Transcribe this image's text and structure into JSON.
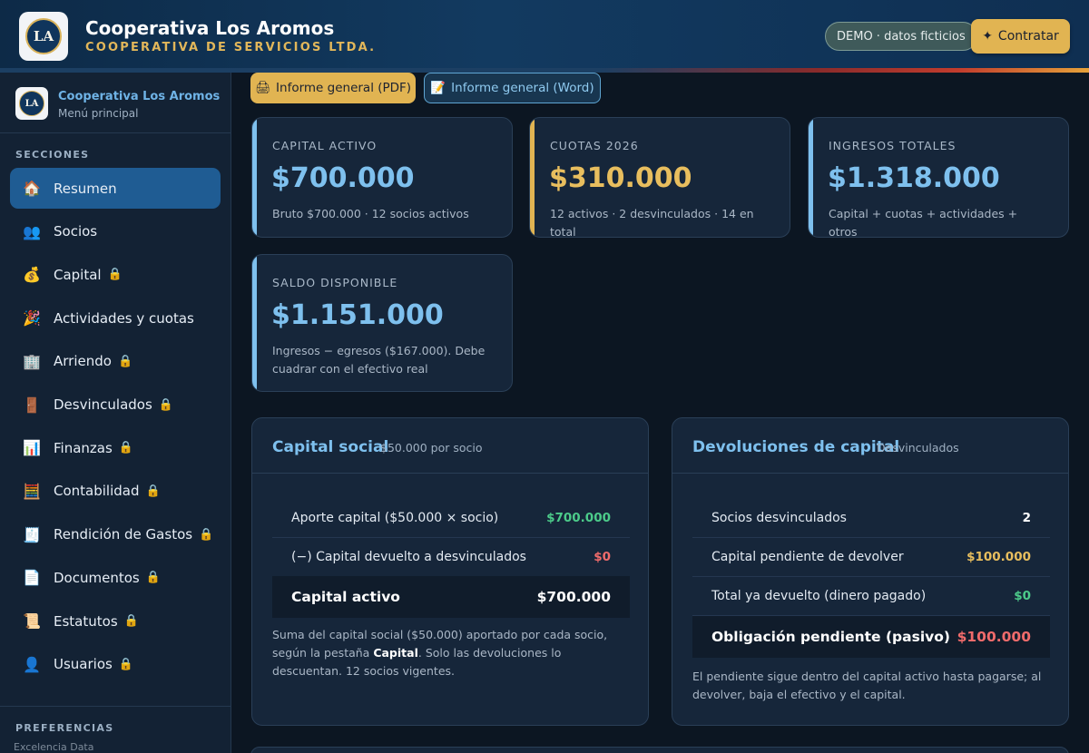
{
  "header": {
    "logo_initials": "LA",
    "title": "Cooperativa Los Aromos",
    "subtitle": "COOPERATIVA DE SERVICIOS LTDA.",
    "demo_badge": "DEMO · datos ficticios",
    "cta_icon": "✦",
    "cta_label": "Contratar"
  },
  "sidebar": {
    "logo_initials": "LA",
    "title": "Cooperativa Los Aromos",
    "subtitle": "Menú principal",
    "sections_label": "SECCIONES",
    "items": [
      {
        "icon": "🏠",
        "icon_name": "home-icon",
        "label": "Resumen",
        "locked": false,
        "active": true
      },
      {
        "icon": "👥",
        "icon_name": "users-icon",
        "label": "Socios",
        "locked": false,
        "active": false
      },
      {
        "icon": "💰",
        "icon_name": "money-bag-icon",
        "label": "Capital",
        "locked": true,
        "active": false
      },
      {
        "icon": "🎉",
        "icon_name": "party-icon",
        "label": "Actividades y cuotas",
        "locked": false,
        "active": false
      },
      {
        "icon": "🏢",
        "icon_name": "building-icon",
        "label": "Arriendo",
        "locked": true,
        "active": false
      },
      {
        "icon": "🚪",
        "icon_name": "door-icon",
        "label": "Desvinculados",
        "locked": true,
        "active": false
      },
      {
        "icon": "📊",
        "icon_name": "bar-chart-icon",
        "label": "Finanzas",
        "locked": true,
        "active": false
      },
      {
        "icon": "🧮",
        "icon_name": "abacus-icon",
        "label": "Contabilidad",
        "locked": true,
        "active": false
      },
      {
        "icon": "🧾",
        "icon_name": "receipt-icon",
        "label": "Rendición de Gastos",
        "locked": true,
        "active": false
      },
      {
        "icon": "📄",
        "icon_name": "document-icon",
        "label": "Documentos",
        "locked": true,
        "active": false
      },
      {
        "icon": "📜",
        "icon_name": "scroll-icon",
        "label": "Estatutos",
        "locked": true,
        "active": false
      },
      {
        "icon": "👤",
        "icon_name": "user-icon",
        "label": "Usuarios",
        "locked": true,
        "active": false
      }
    ],
    "lock_icon": "🔒",
    "preferences_label": "PREFERENCIAS",
    "footer_note": "Excelencia Data"
  },
  "reports": {
    "pdf_icon": "🖨",
    "pdf_label": "Informe general (PDF)",
    "word_icon": "📝",
    "word_label": "Informe general (Word)"
  },
  "kpis": [
    {
      "label": "CAPITAL ACTIVO",
      "value": "$700.000",
      "desc": "Bruto $700.000 · 12 socios activos",
      "accent": "#7ec0ee"
    },
    {
      "label": "CUOTAS 2026",
      "value": "$310.000",
      "desc": "12 activos · 2 desvinculados · 14 en total",
      "accent": "#e1b452"
    },
    {
      "label": "INGRESOS TOTALES",
      "value": "$1.318.000",
      "desc": "Capital + cuotas + actividades + otros",
      "accent": "#7ec0ee"
    },
    {
      "label": "SALDO DISPONIBLE",
      "value": "$1.151.000",
      "desc": "Ingresos − egresos ($167.000). Debe cuadrar con el efectivo real",
      "accent": "#7ec0ee"
    }
  ],
  "capital_social": {
    "title": "Capital social",
    "tag": "$50.000 por socio",
    "rows": [
      {
        "label": "Aporte capital ($50.000 × socio)",
        "value": "$700.000"
      },
      {
        "label": "(−) Capital devuelto a desvinculados",
        "value": "$0"
      }
    ],
    "total_label": "Capital activo",
    "total_value": "$700.000",
    "note_pre": "Suma del capital social ($50.000) aportado por cada socio, según la pestaña ",
    "note_bold": "Capital",
    "note_post": ". Solo las devoluciones lo descuentan. 12 socios vigentes."
  },
  "devoluciones": {
    "title": "Devoluciones de capital",
    "tag": "Desvinculados",
    "rows": [
      {
        "label": "Socios desvinculados",
        "value": "2"
      },
      {
        "label": "Capital pendiente de devolver",
        "value": "$100.000"
      },
      {
        "label": "Total ya devuelto (dinero pagado)",
        "value": "$0"
      }
    ],
    "total_label": "Obligación pendiente (pasivo)",
    "total_value": "$100.000",
    "note": "El pendiente sigue dentro del capital activo hasta pagarse; al devolver, baja el efectivo y el capital."
  },
  "colors": {
    "accent_blue": "#7ec0ee",
    "accent_gold": "#e1b452",
    "positive": "#4ccb8a",
    "negative": "#f06b6b"
  }
}
